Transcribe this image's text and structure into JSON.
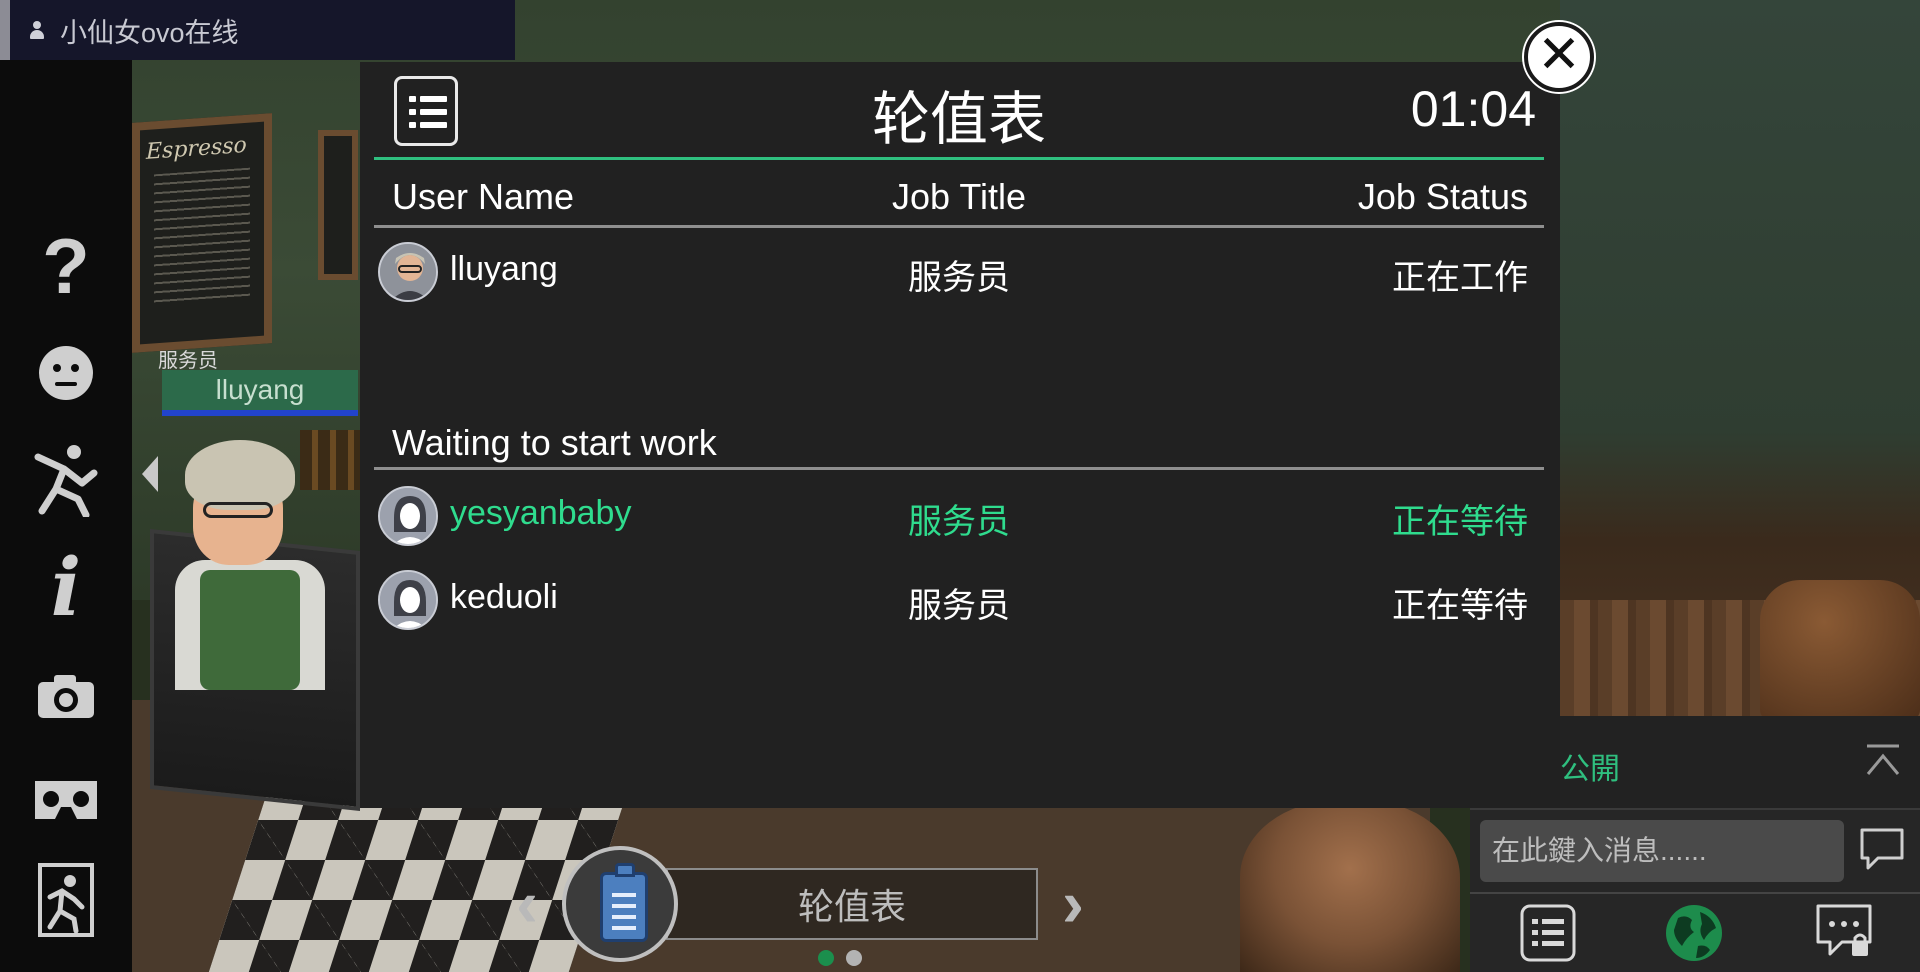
{
  "online_badge": {
    "text": "小仙女ovo在线",
    "icon": "user-icon"
  },
  "scene": {
    "role_label": "服务员",
    "nametag": "lluyang",
    "menu_board_title": "Espresso"
  },
  "left_rail": {
    "items": [
      {
        "icon": "help-icon"
      },
      {
        "icon": "emote-icon"
      },
      {
        "icon": "action-icon"
      },
      {
        "icon": "info-icon"
      },
      {
        "icon": "camera-icon"
      },
      {
        "icon": "vr-headset-icon"
      },
      {
        "icon": "exit-icon"
      }
    ]
  },
  "panel": {
    "title": "轮值表",
    "timer": "01:04",
    "columns": {
      "user_name": "User Name",
      "job_title": "Job Title",
      "job_status": "Job Status"
    },
    "working": [
      {
        "user": "lluyang",
        "job_title": "服务员",
        "status": "正在工作",
        "avatar": "male-avatar"
      }
    ],
    "waiting_heading": "Waiting to start work",
    "waiting": [
      {
        "user": "yesyanbaby",
        "job_title": "服务员",
        "status": "正在等待",
        "avatar": "default-avatar",
        "highlight": true
      },
      {
        "user": "keduoli",
        "job_title": "服务员",
        "status": "正在等待",
        "avatar": "default-avatar",
        "highlight": false
      }
    ]
  },
  "carousel": {
    "label": "轮值表",
    "tool_icon": "clipboard-icon",
    "pages": 2,
    "current_page": 1
  },
  "chat": {
    "channel": "公開",
    "input_placeholder": "在此鍵入消息......",
    "tabs": [
      "list-icon",
      "globe-icon",
      "private-chat-icon"
    ]
  },
  "colors": {
    "accent_green": "#2fdc8e",
    "divider_green": "#2fbf7f",
    "panel_bg": "#212121"
  }
}
